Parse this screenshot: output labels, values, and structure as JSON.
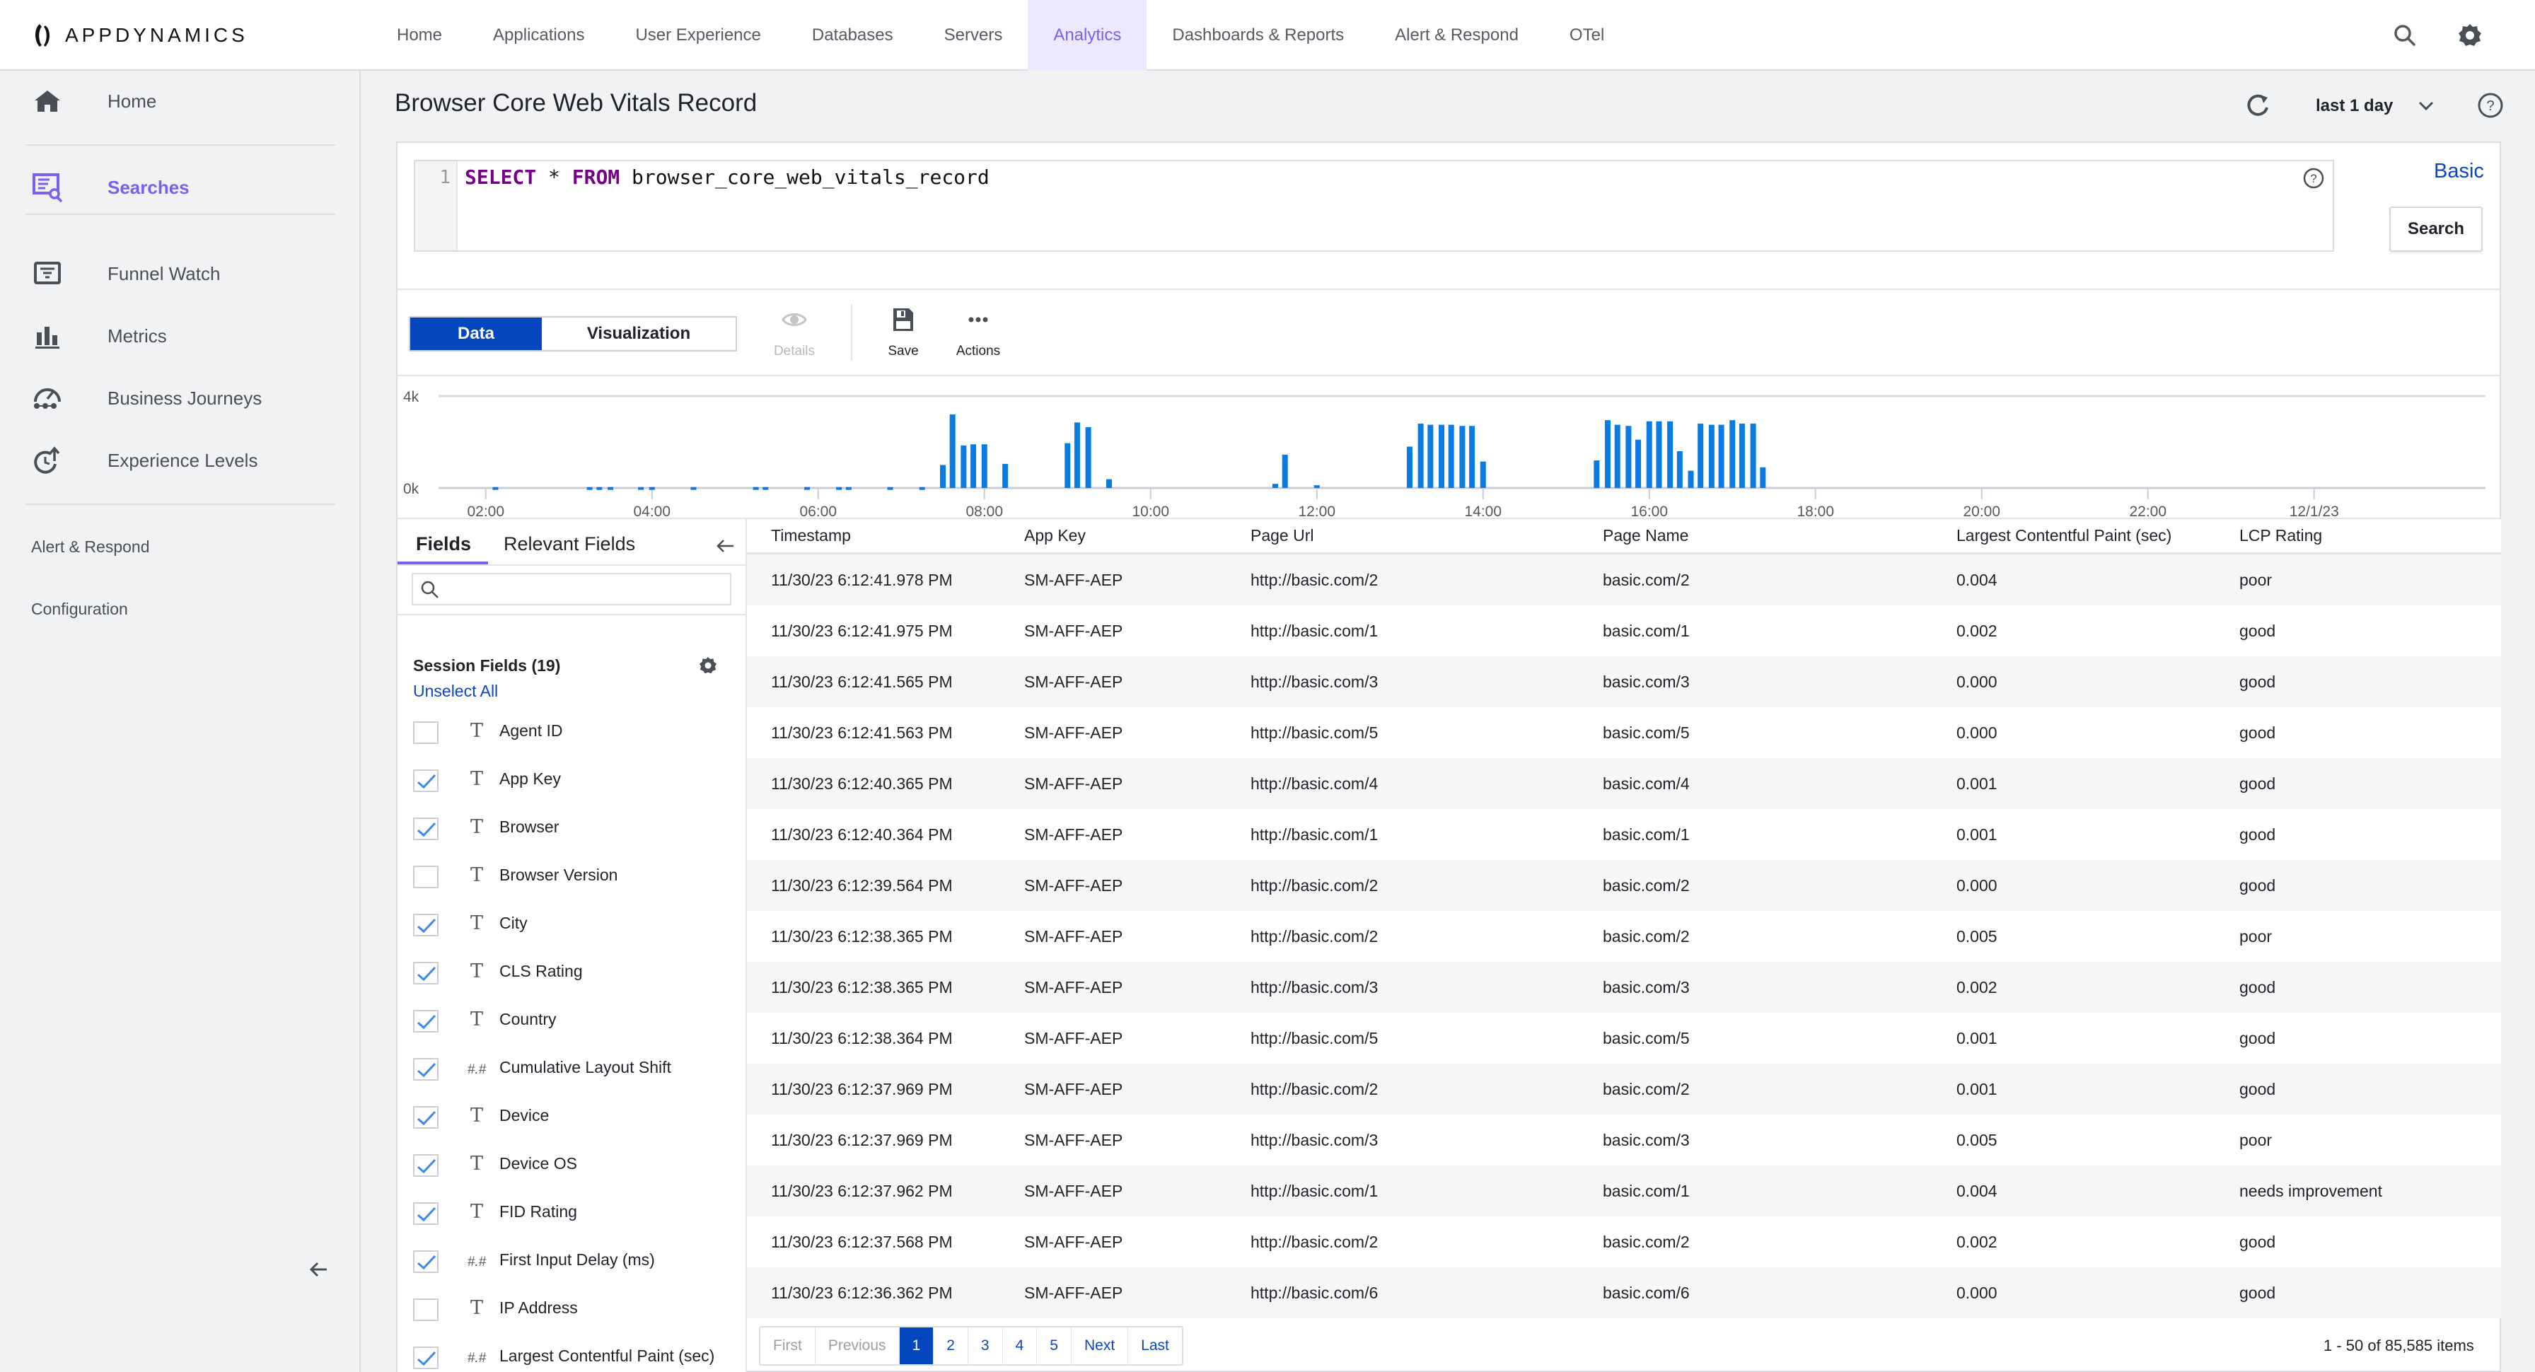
{
  "app": {
    "brand": "APPDYNAMICS"
  },
  "topnav": {
    "items": [
      {
        "label": "Home"
      },
      {
        "label": "Applications"
      },
      {
        "label": "User Experience"
      },
      {
        "label": "Databases"
      },
      {
        "label": "Servers"
      },
      {
        "label": "Analytics",
        "active": true
      },
      {
        "label": "Dashboards & Reports"
      },
      {
        "label": "Alert & Respond"
      },
      {
        "label": "OTel"
      }
    ],
    "icons": [
      "search-icon",
      "gear-icon"
    ]
  },
  "sidebar": {
    "items": [
      {
        "label": "Home",
        "icon": "home-icon"
      },
      {
        "label": "Searches",
        "icon": "searches-icon",
        "active": true
      },
      {
        "label": "Funnel Watch",
        "icon": "funnel-watch-icon"
      },
      {
        "label": "Metrics",
        "icon": "bar-chart-icon"
      },
      {
        "label": "Business Journeys",
        "icon": "business-journeys-icon"
      },
      {
        "label": "Experience Levels",
        "icon": "experience-levels-icon"
      }
    ],
    "links": [
      {
        "label": "Alert & Respond"
      },
      {
        "label": "Configuration"
      }
    ]
  },
  "page": {
    "title": "Browser Core Web Vitals Record",
    "time_range": "last 1 day"
  },
  "query": {
    "line_number": "1",
    "keyword_select": "SELECT",
    "star": " * ",
    "keyword_from": "FROM",
    "table": " browser_core_web_vitals_record",
    "mode_link": "Basic",
    "search_label": "Search"
  },
  "toolbar": {
    "data_label": "Data",
    "visualization_label": "Visualization",
    "details_label": "Details",
    "save_label": "Save",
    "actions_label": "Actions"
  },
  "chart_data": {
    "type": "bar",
    "title": "",
    "xlabel": "",
    "ylabel": "",
    "ylim": [
      0,
      4000
    ],
    "y_ticks": [
      "0k",
      "4k"
    ],
    "x_ticks": [
      "02:00",
      "04:00",
      "06:00",
      "08:00",
      "10:00",
      "12:00",
      "14:00",
      "16:00",
      "18:00",
      "20:00",
      "22:00",
      "12/1/23"
    ],
    "x_start_hour": 1.5,
    "bin_minutes": 7.5,
    "grid": true,
    "bar_color": "#0a7be0",
    "bars": [
      {
        "t": "02:07",
        "value": 40
      },
      {
        "t": "03:15",
        "value": 40
      },
      {
        "t": "03:22",
        "value": 40
      },
      {
        "t": "03:30",
        "value": 40
      },
      {
        "t": "03:52",
        "value": 40
      },
      {
        "t": "04:00",
        "value": 40
      },
      {
        "t": "04:30",
        "value": 40
      },
      {
        "t": "05:15",
        "value": 40
      },
      {
        "t": "05:22",
        "value": 40
      },
      {
        "t": "05:52",
        "value": 40
      },
      {
        "t": "06:15",
        "value": 40
      },
      {
        "t": "06:22",
        "value": 40
      },
      {
        "t": "06:52",
        "value": 40
      },
      {
        "t": "07:15",
        "value": 40
      },
      {
        "t": "07:30",
        "value": 1000
      },
      {
        "t": "07:37",
        "value": 3200
      },
      {
        "t": "07:45",
        "value": 1850
      },
      {
        "t": "07:52",
        "value": 1900
      },
      {
        "t": "08:00",
        "value": 1900
      },
      {
        "t": "08:15",
        "value": 1050
      },
      {
        "t": "09:00",
        "value": 1950
      },
      {
        "t": "09:07",
        "value": 2850
      },
      {
        "t": "09:15",
        "value": 2650
      },
      {
        "t": "09:30",
        "value": 380
      },
      {
        "t": "11:30",
        "value": 180
      },
      {
        "t": "11:37",
        "value": 1450
      },
      {
        "t": "12:00",
        "value": 120
      },
      {
        "t": "13:07",
        "value": 1800
      },
      {
        "t": "13:15",
        "value": 2800
      },
      {
        "t": "13:22",
        "value": 2750
      },
      {
        "t": "13:30",
        "value": 2750
      },
      {
        "t": "13:37",
        "value": 2750
      },
      {
        "t": "13:45",
        "value": 2700
      },
      {
        "t": "13:52",
        "value": 2700
      },
      {
        "t": "14:00",
        "value": 1150
      },
      {
        "t": "15:22",
        "value": 1200
      },
      {
        "t": "15:30",
        "value": 2950
      },
      {
        "t": "15:37",
        "value": 2750
      },
      {
        "t": "15:45",
        "value": 2700
      },
      {
        "t": "15:52",
        "value": 2100
      },
      {
        "t": "16:00",
        "value": 2900
      },
      {
        "t": "16:07",
        "value": 2900
      },
      {
        "t": "16:15",
        "value": 2900
      },
      {
        "t": "16:22",
        "value": 1600
      },
      {
        "t": "16:30",
        "value": 750
      },
      {
        "t": "16:37",
        "value": 2800
      },
      {
        "t": "16:45",
        "value": 2750
      },
      {
        "t": "16:52",
        "value": 2750
      },
      {
        "t": "17:00",
        "value": 2950
      },
      {
        "t": "17:07",
        "value": 2800
      },
      {
        "t": "17:15",
        "value": 2800
      },
      {
        "t": "17:22",
        "value": 900
      }
    ]
  },
  "fields": {
    "tab_fields": "Fields",
    "tab_relevant": "Relevant Fields",
    "search_placeholder": "",
    "section_title": "Session Fields (19)",
    "unselect_all": "Unselect All",
    "items": [
      {
        "name": "Agent ID",
        "type": "T",
        "checked": false
      },
      {
        "name": "App Key",
        "type": "T",
        "checked": true
      },
      {
        "name": "Browser",
        "type": "T",
        "checked": true
      },
      {
        "name": "Browser Version",
        "type": "T",
        "checked": false
      },
      {
        "name": "City",
        "type": "T",
        "checked": true
      },
      {
        "name": "CLS Rating",
        "type": "T",
        "checked": true
      },
      {
        "name": "Country",
        "type": "T",
        "checked": true
      },
      {
        "name": "Cumulative Layout Shift",
        "type": "#.#",
        "checked": true
      },
      {
        "name": "Device",
        "type": "T",
        "checked": true
      },
      {
        "name": "Device OS",
        "type": "T",
        "checked": true
      },
      {
        "name": "FID Rating",
        "type": "T",
        "checked": true
      },
      {
        "name": "First Input Delay (ms)",
        "type": "#.#",
        "checked": true
      },
      {
        "name": "IP Address",
        "type": "T",
        "checked": false
      },
      {
        "name": "Largest Contentful Paint (sec)",
        "type": "#.#",
        "checked": true
      }
    ]
  },
  "table": {
    "columns": [
      "Timestamp",
      "App Key",
      "Page Url",
      "Page Name",
      "Largest Contentful Paint (sec)",
      "LCP Rating"
    ],
    "rows": [
      [
        "11/30/23 6:12:41.978 PM",
        "SM-AFF-AEP",
        "http://basic.com/2",
        "basic.com/2",
        "0.004",
        "poor"
      ],
      [
        "11/30/23 6:12:41.975 PM",
        "SM-AFF-AEP",
        "http://basic.com/1",
        "basic.com/1",
        "0.002",
        "good"
      ],
      [
        "11/30/23 6:12:41.565 PM",
        "SM-AFF-AEP",
        "http://basic.com/3",
        "basic.com/3",
        "0.000",
        "good"
      ],
      [
        "11/30/23 6:12:41.563 PM",
        "SM-AFF-AEP",
        "http://basic.com/5",
        "basic.com/5",
        "0.000",
        "good"
      ],
      [
        "11/30/23 6:12:40.365 PM",
        "SM-AFF-AEP",
        "http://basic.com/4",
        "basic.com/4",
        "0.001",
        "good"
      ],
      [
        "11/30/23 6:12:40.364 PM",
        "SM-AFF-AEP",
        "http://basic.com/1",
        "basic.com/1",
        "0.001",
        "good"
      ],
      [
        "11/30/23 6:12:39.564 PM",
        "SM-AFF-AEP",
        "http://basic.com/2",
        "basic.com/2",
        "0.000",
        "good"
      ],
      [
        "11/30/23 6:12:38.365 PM",
        "SM-AFF-AEP",
        "http://basic.com/2",
        "basic.com/2",
        "0.005",
        "poor"
      ],
      [
        "11/30/23 6:12:38.365 PM",
        "SM-AFF-AEP",
        "http://basic.com/3",
        "basic.com/3",
        "0.002",
        "good"
      ],
      [
        "11/30/23 6:12:38.364 PM",
        "SM-AFF-AEP",
        "http://basic.com/5",
        "basic.com/5",
        "0.001",
        "good"
      ],
      [
        "11/30/23 6:12:37.969 PM",
        "SM-AFF-AEP",
        "http://basic.com/2",
        "basic.com/2",
        "0.001",
        "good"
      ],
      [
        "11/30/23 6:12:37.969 PM",
        "SM-AFF-AEP",
        "http://basic.com/3",
        "basic.com/3",
        "0.005",
        "poor"
      ],
      [
        "11/30/23 6:12:37.962 PM",
        "SM-AFF-AEP",
        "http://basic.com/1",
        "basic.com/1",
        "0.004",
        "needs improvement"
      ],
      [
        "11/30/23 6:12:37.568 PM",
        "SM-AFF-AEP",
        "http://basic.com/2",
        "basic.com/2",
        "0.002",
        "good"
      ],
      [
        "11/30/23 6:12:36.362 PM",
        "SM-AFF-AEP",
        "http://basic.com/6",
        "basic.com/6",
        "0.000",
        "good"
      ]
    ]
  },
  "pagination": {
    "first": "First",
    "previous": "Previous",
    "pages": [
      "1",
      "2",
      "3",
      "4",
      "5"
    ],
    "current": "1",
    "next": "Next",
    "last": "Last",
    "summary": "1 - 50 of 85,585 items"
  },
  "colors": {
    "accent": "#7a5ff0",
    "primary_blue": "#0446bd",
    "link_blue": "#0a46c1",
    "bar_blue": "#0a7be0"
  }
}
